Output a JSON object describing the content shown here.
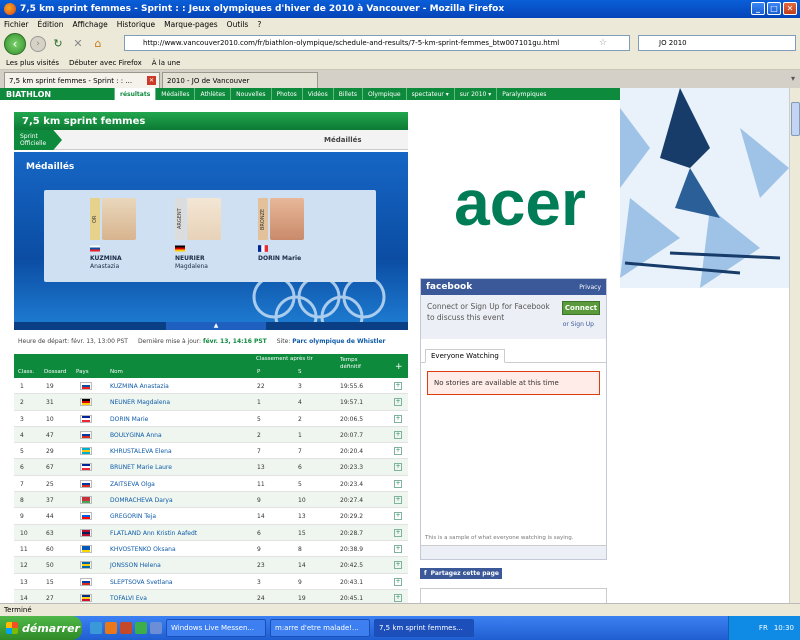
{
  "window": {
    "title": "7,5 km sprint femmes - Sprint : : Jeux olympiques d'hiver de 2010 à Vancouver - Mozilla Firefox",
    "min": "_",
    "max": "□",
    "close": "✕"
  },
  "menu": [
    "Fichier",
    "Édition",
    "Affichage",
    "Historique",
    "Marque-pages",
    "Outils",
    "?"
  ],
  "nav": {
    "url": "http://www.vancouver2010.com/fr/biathlon-olympique/schedule-and-results/7-5-km-sprint-femmes_btw007101gu.html",
    "search": "JO 2010"
  },
  "bookmarks": [
    "Les plus visités",
    "Débuter avec Firefox",
    "À la une"
  ],
  "tabs": [
    {
      "label": "7,5 km sprint femmes - Sprint : : ..."
    },
    {
      "label": "2010 - JO de Vancouver"
    }
  ],
  "site": {
    "brand": "BIATHLON",
    "nav": [
      "résultats",
      "Médailles",
      "Athlètes",
      "Nouvelles",
      "Photos",
      "Vidéos",
      "Billets",
      "Olympique",
      "spectateur ▾",
      "sur 2010 ▾",
      "Paralympiques"
    ],
    "race_title": "7,5 km sprint femmes",
    "pill_line1": "Sprint",
    "pill_line2": "Officielle",
    "medal_tab": "Médaillés",
    "podium_title": "Médaillés",
    "medalists": [
      {
        "medal": "OR",
        "last": "KUZMINA",
        "first": "Anastazia",
        "photo": "#d8b48e",
        "flag": [
          "#ffffff",
          "#0b4ea2",
          "#ee1c25"
        ]
      },
      {
        "medal": "ARGENT",
        "last": "NEURIER",
        "first": "Magdalena",
        "photo": "#e8d2b8",
        "flag": [
          "#000000",
          "#dd0000",
          "#ffce00"
        ]
      },
      {
        "medal": "BRONZE",
        "last": "DORIN Marie",
        "first": "",
        "photo": "#c98a6a",
        "flag": [
          "#002395",
          "#ffffff",
          "#ed2939"
        ]
      }
    ],
    "start_label": "Heure de départ:",
    "start_value": "févr. 13, 13:00 PST",
    "updated_label": "Dernière mise à jour:",
    "updated_value": "févr. 13, 14:16 PST",
    "site_label": "Site:",
    "site_value": "Parc olympique de Whistler"
  },
  "results": {
    "headers": {
      "clas": "Class.",
      "dossard": "Dossard",
      "pays": "Pays",
      "nom": "Nom",
      "classement": "Classement après tir",
      "p": "P",
      "s": "S",
      "temps": "Temps définitif",
      "more": "+"
    },
    "rows": [
      {
        "rank": "1",
        "bib": "19",
        "name": "KUZMINA Anastazia",
        "p": "22",
        "s": "3",
        "time": "19:55.6",
        "flag": [
          "#ffffff",
          "#0b4ea2",
          "#ee1c25"
        ]
      },
      {
        "rank": "2",
        "bib": "31",
        "name": "NEUNER Magdalena",
        "p": "1",
        "s": "4",
        "time": "19:57.1",
        "flag": [
          "#000000",
          "#dd0000",
          "#ffce00"
        ]
      },
      {
        "rank": "3",
        "bib": "10",
        "name": "DORIN Marie",
        "p": "5",
        "s": "2",
        "time": "20:06.5",
        "flag": [
          "#002395",
          "#ffffff",
          "#ed2939"
        ]
      },
      {
        "rank": "4",
        "bib": "47",
        "name": "BOULYGINA Anna",
        "p": "2",
        "s": "1",
        "time": "20:07.7",
        "flag": [
          "#ffffff",
          "#0039a6",
          "#d52b1e"
        ]
      },
      {
        "rank": "5",
        "bib": "29",
        "name": "KHRUSTALEVA Elena",
        "p": "7",
        "s": "7",
        "time": "20:20.4",
        "flag": [
          "#00afca",
          "#fec50c",
          "#00afca"
        ]
      },
      {
        "rank": "6",
        "bib": "67",
        "name": "BRUNET Marie Laure",
        "p": "13",
        "s": "6",
        "time": "20:23.3",
        "flag": [
          "#002395",
          "#ffffff",
          "#ed2939"
        ]
      },
      {
        "rank": "7",
        "bib": "25",
        "name": "ZAITSEVA Olga",
        "p": "11",
        "s": "5",
        "time": "20:23.4",
        "flag": [
          "#ffffff",
          "#0039a6",
          "#d52b1e"
        ]
      },
      {
        "rank": "8",
        "bib": "37",
        "name": "DOMRACHEVA Darya",
        "p": "9",
        "s": "10",
        "time": "20:27.4",
        "flag": [
          "#c8313e",
          "#c8313e",
          "#4aa657"
        ]
      },
      {
        "rank": "9",
        "bib": "44",
        "name": "GREGORIN Teja",
        "p": "14",
        "s": "13",
        "time": "20:29.2",
        "flag": [
          "#ffffff",
          "#005ce5",
          "#ff0000"
        ]
      },
      {
        "rank": "10",
        "bib": "63",
        "name": "FLATLAND Ann Kristin Aafedt",
        "p": "6",
        "s": "15",
        "time": "20:28.7",
        "flag": [
          "#ba0c2f",
          "#00205b",
          "#ba0c2f"
        ]
      },
      {
        "rank": "11",
        "bib": "60",
        "name": "KHVOSTENKO Oksana",
        "p": "9",
        "s": "8",
        "time": "20:38.9",
        "flag": [
          "#0057b7",
          "#0057b7",
          "#ffd700"
        ]
      },
      {
        "rank": "12",
        "bib": "50",
        "name": "JONSSON Helena",
        "p": "23",
        "s": "14",
        "time": "20:42.5",
        "flag": [
          "#006aa7",
          "#fecc00",
          "#006aa7"
        ]
      },
      {
        "rank": "13",
        "bib": "15",
        "name": "SLEPTSOVA Svetlana",
        "p": "3",
        "s": "9",
        "time": "20:43.1",
        "flag": [
          "#ffffff",
          "#0039a6",
          "#d52b1e"
        ]
      },
      {
        "rank": "14",
        "bib": "27",
        "name": "TOFALVI Eva",
        "p": "24",
        "s": "19",
        "time": "20:45.1",
        "flag": [
          "#002b7f",
          "#fcd116",
          "#ce1126"
        ]
      }
    ]
  },
  "facebook": {
    "logo": "facebook",
    "privacy": "Privacy",
    "connect_text": "Connect or Sign Up for Facebook to discuss this event",
    "connect_btn": "Connect",
    "signup": "or Sign Up",
    "tab": "Everyone Watching",
    "nostories": "No stories are available at this time",
    "sample": "This is a sample of what everyone watching is saying.",
    "share": "Partagez cette page"
  },
  "ad": {
    "brand": "acer"
  },
  "status": "Terminé",
  "taskbar": {
    "start": "démarrer",
    "items": [
      "Windows Live Messen...",
      "m:arre d'etre malade!...",
      "7,5 km sprint femmes..."
    ],
    "lang": "FR",
    "clock": "10:30"
  },
  "colors": {
    "olympic_green": "#0e8a3d",
    "facebook_blue": "#3b5998",
    "acer_green": "#007c56"
  }
}
